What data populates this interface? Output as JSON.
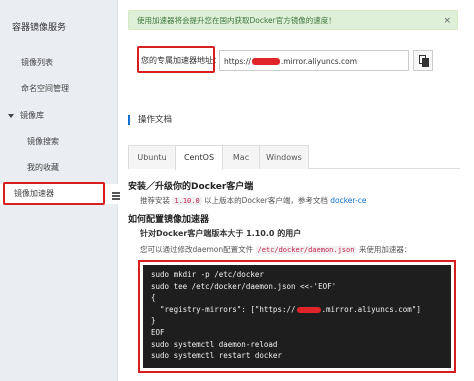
{
  "sidebar": {
    "title": "容器镜像服务",
    "items": [
      {
        "label": "镜像列表"
      },
      {
        "label": "命名空间管理"
      },
      {
        "label": "镜像库"
      },
      {
        "label": "镜像搜索"
      },
      {
        "label": "我的收藏"
      },
      {
        "label": "镜像加速器"
      }
    ]
  },
  "notice": {
    "text": "使用加速器将会提升您在国内获取Docker官方镜像的速度！",
    "close": "×"
  },
  "accelerator": {
    "label": "您的专属加速器地址：",
    "prefix": "https://",
    "suffix": ".mirror.aliyuncs.com"
  },
  "section_title": "操作文档",
  "tabs": [
    "Ubuntu",
    "CentOS",
    "Mac",
    "Windows"
  ],
  "active_tab": "CentOS",
  "install": {
    "heading": "安装／升级你的Docker客户端",
    "desc_before": "推荐安装 ",
    "version": "1.10.0",
    "desc_after": " 以上版本的Docker客户端，参考文档 ",
    "link": "docker-ce"
  },
  "config": {
    "heading": "如何配置镜像加速器",
    "subheading": "针对Docker客户端版本大于 1.10.0 的用户",
    "desc_before": "您可以通过修改daemon配置文件 ",
    "path": "/etc/docker/daemon.json",
    "desc_after": " 来使用加速器："
  },
  "code": {
    "lines": [
      "sudo mkdir -p /etc/docker",
      "sudo tee /etc/docker/daemon.json <<-'EOF'",
      "{",
      "  \"registry-mirrors\": [\"https://",
      "}",
      "EOF",
      "sudo systemctl daemon-reload",
      "sudo systemctl restart docker"
    ],
    "mirror_suffix": ".mirror.aliyuncs.com\"]"
  },
  "colors": {
    "highlight_border": "#d81e1e",
    "sidebar_bg": "#eaedf1",
    "notice_bg": "#dff0d8",
    "link": "#0a6fd0",
    "code_bg": "#1e1e1e"
  }
}
